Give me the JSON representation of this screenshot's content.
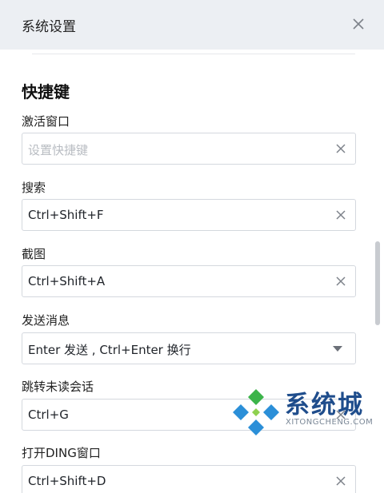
{
  "window": {
    "title": "系统设置",
    "close_icon": "close-icon"
  },
  "section": {
    "title": "快捷键"
  },
  "fields": [
    {
      "label": "激活窗口",
      "value": "",
      "placeholder": "设置快捷键",
      "control": "clear"
    },
    {
      "label": "搜索",
      "value": "Ctrl+Shift+F",
      "control": "clear"
    },
    {
      "label": "截图",
      "value": "Ctrl+Shift+A",
      "control": "clear"
    },
    {
      "label": "发送消息",
      "value": "Enter 发送 , Ctrl+Enter 换行",
      "control": "dropdown"
    },
    {
      "label": "跳转未读会话",
      "value": "Ctrl+G",
      "control": "clear"
    },
    {
      "label": "打开DING窗口",
      "value": "Ctrl+Shift+D",
      "control": "clear"
    }
  ],
  "watermark": {
    "name": "系统城",
    "url": "XITONGCHENG.COM"
  },
  "colors": {
    "titlebar_bg": "#eceff3",
    "border": "#d4d8de",
    "placeholder": "#b8bcc2",
    "scrollbar": "#c8cbd0",
    "logo_green": "#3cb44a",
    "logo_blue": "#2b8fd8"
  }
}
